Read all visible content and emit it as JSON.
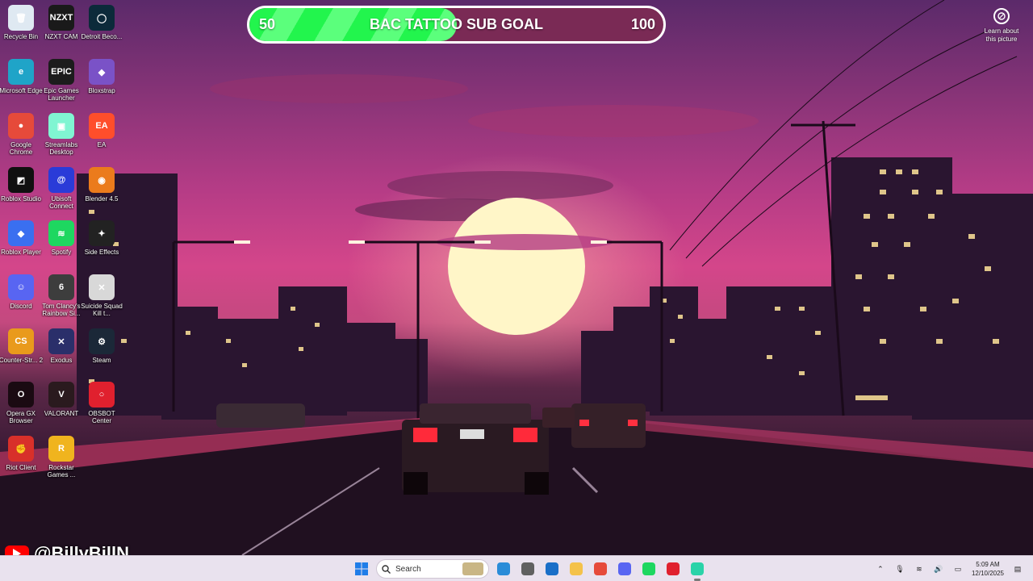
{
  "goal": {
    "start": "50",
    "end": "100",
    "title": "BAC TATTOO SUB GOAL",
    "progress": 0.5
  },
  "learn": {
    "label": "Learn about this picture",
    "icon": "camera-icon"
  },
  "channel": {
    "handle": "@BillyBillN",
    "icon": "youtube-icon"
  },
  "desktop_icons": [
    {
      "name": "recycle-bin",
      "label": "Recycle Bin",
      "color": "#dfe9f2",
      "glyph": "🗑"
    },
    {
      "name": "nzxt-cam",
      "label": "NZXT CAM",
      "color": "#1a1a1a",
      "glyph": "NZXT"
    },
    {
      "name": "detroit",
      "label": "Detroit Beco...",
      "color": "#0c2a3a",
      "glyph": "◯"
    },
    {
      "name": "microsoft-edge",
      "label": "Microsoft Edge",
      "color": "#1fa4c8",
      "glyph": "e"
    },
    {
      "name": "epic-games",
      "label": "Epic Games Launcher",
      "color": "#1c1c1c",
      "glyph": "EPIC"
    },
    {
      "name": "bloxstrap",
      "label": "Bloxstrap",
      "color": "#7a52c7",
      "glyph": "◆"
    },
    {
      "name": "google-chrome",
      "label": "Google Chrome",
      "color": "#e64a3a",
      "glyph": "●"
    },
    {
      "name": "streamlabs",
      "label": "Streamlabs Desktop",
      "color": "#80f5d2",
      "glyph": "▣"
    },
    {
      "name": "ea",
      "label": "EA",
      "color": "#ff4e2b",
      "glyph": "EA"
    },
    {
      "name": "roblox-studio",
      "label": "Roblox Studio",
      "color": "#101010",
      "glyph": "◩"
    },
    {
      "name": "ubisoft",
      "label": "Ubisoft Connect",
      "color": "#2a3bd8",
      "glyph": "@"
    },
    {
      "name": "blender",
      "label": "Blender 4.5",
      "color": "#eb7b1c",
      "glyph": "◉"
    },
    {
      "name": "roblox-player",
      "label": "Roblox Player",
      "color": "#3a6ff0",
      "glyph": "◆"
    },
    {
      "name": "spotify",
      "label": "Spotify",
      "color": "#1ed760",
      "glyph": "≋"
    },
    {
      "name": "side-effects",
      "label": "Side Effects",
      "color": "#222222",
      "glyph": "✦"
    },
    {
      "name": "discord",
      "label": "Discord",
      "color": "#5865f2",
      "glyph": "☺"
    },
    {
      "name": "rainbow-six",
      "label": "Tom Clancy's Rainbow Si...",
      "color": "#3d3d3d",
      "glyph": "6"
    },
    {
      "name": "suicide-squad",
      "label": "Suicide Squad Kill t...",
      "color": "#d8d8d8",
      "glyph": "✕"
    },
    {
      "name": "counter-strike",
      "label": "Counter-Str... 2",
      "color": "#e99a1c",
      "glyph": "CS"
    },
    {
      "name": "exodus",
      "label": "Exodus",
      "color": "#2a2f6a",
      "glyph": "✕"
    },
    {
      "name": "steam",
      "label": "Steam",
      "color": "#1b2838",
      "glyph": "⚙"
    },
    {
      "name": "opera-gx",
      "label": "Opera GX Browser",
      "color": "#1a0a12",
      "glyph": "O"
    },
    {
      "name": "valorant",
      "label": "VALORANT",
      "color": "#2a1a1e",
      "glyph": "V"
    },
    {
      "name": "obsbot",
      "label": "OBSBOT Center",
      "color": "#e0202e",
      "glyph": "○"
    },
    {
      "name": "riot-client",
      "label": "Riot Client",
      "color": "#d8302a",
      "glyph": "✊"
    },
    {
      "name": "rockstar",
      "label": "Rockstar Games ...",
      "color": "#f0b41e",
      "glyph": "R"
    }
  ],
  "taskbar": {
    "search_placeholder": "Search",
    "apps": [
      {
        "name": "file-explorer",
        "color": "#2a8cd8"
      },
      {
        "name": "mouse-app",
        "color": "#606060"
      },
      {
        "name": "photos",
        "color": "#1a6fc8"
      },
      {
        "name": "folder",
        "color": "#f4c24a"
      },
      {
        "name": "chrome",
        "color": "#e64a3a"
      },
      {
        "name": "discord",
        "color": "#5865f2"
      },
      {
        "name": "spotify",
        "color": "#1ed760"
      },
      {
        "name": "opera",
        "color": "#e0202e"
      },
      {
        "name": "streamlabs",
        "color": "#2ad3a8"
      }
    ],
    "time": "5:09 AM",
    "date": "12/10/2025"
  }
}
